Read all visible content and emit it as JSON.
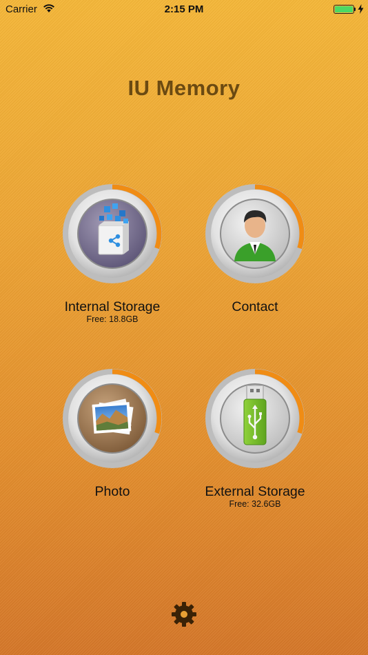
{
  "status_bar": {
    "carrier": "Carrier",
    "time": "2:15 PM",
    "battery_icon": "battery-full-icon",
    "wifi_icon": "wifi-icon",
    "charging_icon": "bolt-icon"
  },
  "app": {
    "title": "IU Memory"
  },
  "tiles": [
    {
      "label": "Internal Storage",
      "sub": "Free: 18.8GB",
      "icon": "storage-share-icon",
      "usage_fraction": 0.3
    },
    {
      "label": "Contact",
      "sub": "",
      "icon": "contact-person-icon",
      "usage_fraction": 0.3
    },
    {
      "label": "Photo",
      "sub": "",
      "icon": "photo-stack-icon",
      "usage_fraction": 0.3
    },
    {
      "label": "External Storage",
      "sub": "Free: 32.6GB",
      "icon": "usb-drive-icon",
      "usage_fraction": 0.3
    }
  ],
  "settings": {
    "icon": "gear-icon"
  },
  "colors": {
    "accent_ring": "#f08c14",
    "title": "#6b4a12",
    "background_top": "#f6b83a",
    "background_bottom": "#d6782a"
  }
}
